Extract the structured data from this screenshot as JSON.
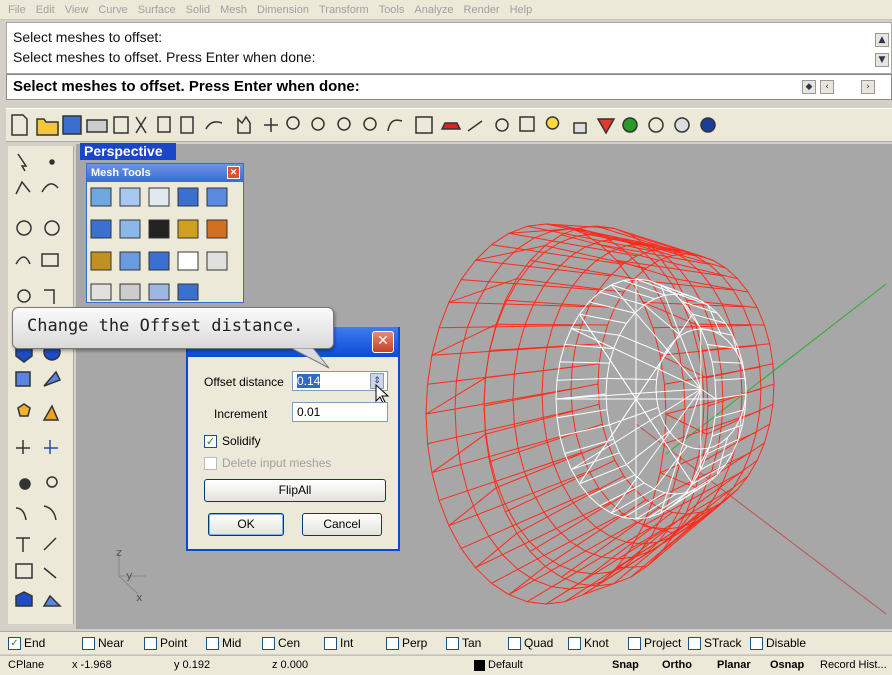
{
  "menu": [
    "File",
    "Edit",
    "View",
    "Curve",
    "Surface",
    "Solid",
    "Mesh",
    "Dimension",
    "Transform",
    "Tools",
    "Analyze",
    "Render",
    "Help"
  ],
  "command_history": [
    "Select meshes to offset:",
    "Select meshes to offset. Press Enter when done:"
  ],
  "command_prompt": {
    "text": "Select meshes to offset. Press Enter when done:"
  },
  "viewport": {
    "title": "Perspective",
    "axis_y": "y",
    "axis_x": "x",
    "axis_z": "z"
  },
  "mesh_tools": {
    "title": "Mesh Tools"
  },
  "callout": {
    "text": "Change the Offset distance."
  },
  "dialog": {
    "offset_label": "Offset distance",
    "offset_value": "0.14",
    "increment_label": "Increment",
    "increment_value": "0.01",
    "solidify_label": "Solidify",
    "solidify_checked": true,
    "delete_label": "Delete input meshes",
    "delete_checked": false,
    "flipall_label": "FlipAll",
    "ok_label": "OK",
    "cancel_label": "Cancel"
  },
  "osnap": [
    {
      "label": "End",
      "checked": true
    },
    {
      "label": "Near",
      "checked": false
    },
    {
      "label": "Point",
      "checked": false
    },
    {
      "label": "Mid",
      "checked": false
    },
    {
      "label": "Cen",
      "checked": false
    },
    {
      "label": "Int",
      "checked": false
    },
    {
      "label": "Perp",
      "checked": false
    },
    {
      "label": "Tan",
      "checked": false
    },
    {
      "label": "Quad",
      "checked": false
    },
    {
      "label": "Knot",
      "checked": false
    },
    {
      "label": "Project",
      "checked": false
    },
    {
      "label": "STrack",
      "checked": false
    },
    {
      "label": "Disable",
      "checked": false
    }
  ],
  "status": {
    "cplane": "CPlane",
    "x": "x -1.968",
    "y": "y 0.192",
    "z": "z 0.000",
    "layer": "Default",
    "snap": "Snap",
    "ortho": "Ortho",
    "planar": "Planar",
    "osnap": "Osnap",
    "record": "Record Hist..."
  },
  "colors": {
    "mesh_red": "#ff2a1a",
    "mesh_white": "#ffffff",
    "viewport_bg": "#a7a7a7",
    "accent": "#0a4ad6"
  }
}
